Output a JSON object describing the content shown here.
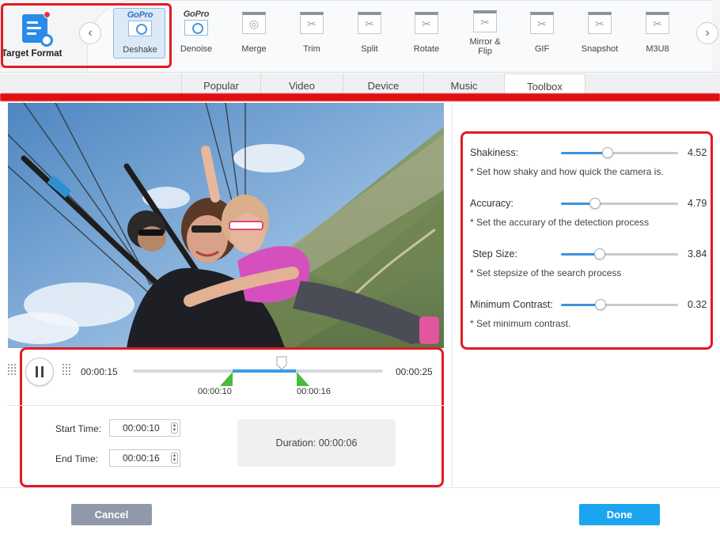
{
  "toolbar": {
    "target_format_label": "Target Format",
    "prev_label": "‹",
    "next_label": "›",
    "gopro_text": "GoPro",
    "tools": [
      {
        "label": "Deshake",
        "icon": "gopro-deshake-icon",
        "selected": true
      },
      {
        "label": "Denoise",
        "icon": "gopro-denoise-icon"
      },
      {
        "label": "Merge",
        "icon": "merge-icon"
      },
      {
        "label": "Trim",
        "icon": "trim-icon"
      },
      {
        "label": "Split",
        "icon": "split-icon"
      },
      {
        "label": "Rotate",
        "icon": "rotate-icon"
      },
      {
        "label": "Mirror & Flip",
        "icon": "mirror-flip-icon"
      },
      {
        "label": "GIF",
        "icon": "gif-icon"
      },
      {
        "label": "Snapshot",
        "icon": "snapshot-icon"
      },
      {
        "label": "M3U8",
        "icon": "m3u8-icon"
      }
    ]
  },
  "tabs": [
    {
      "label": "Popular"
    },
    {
      "label": "Video"
    },
    {
      "label": "Device"
    },
    {
      "label": "Music"
    },
    {
      "label": "Toolbox",
      "active": true
    }
  ],
  "settings": {
    "shakiness": {
      "label": "Shakiness:",
      "value": "4.52",
      "fraction": 0.4,
      "hint": "* Set how shaky and how quick the camera is."
    },
    "accuracy": {
      "label": "Accuracy:",
      "value": "4.79",
      "fraction": 0.29,
      "hint": "* Set the accurary of the detection process"
    },
    "step_size": {
      "label": "Step Size:",
      "value": "3.84",
      "fraction": 0.33,
      "hint": "* Set stepsize of the search process"
    },
    "min_contrast": {
      "label": "Minimum Contrast:",
      "value": "0.32",
      "fraction": 0.34,
      "hint": "* Set minimum contrast."
    }
  },
  "timeline": {
    "current_time": "00:00:15",
    "end_time": "00:00:25",
    "start_marker": "00:00:10",
    "end_marker": "00:00:16"
  },
  "trim": {
    "start_label": "Start Time:",
    "start_value": "00:00:10",
    "end_label": "End Time:",
    "end_value": "00:00:16",
    "duration_label": "Duration:",
    "duration_value": "00:00:06"
  },
  "footer": {
    "cancel_label": "Cancel",
    "done_label": "Done"
  },
  "colors": {
    "accent": "#1ba4ef",
    "slider": "#3c93dd",
    "highlight": "#e11b22",
    "marker": "#4cbb3c"
  }
}
